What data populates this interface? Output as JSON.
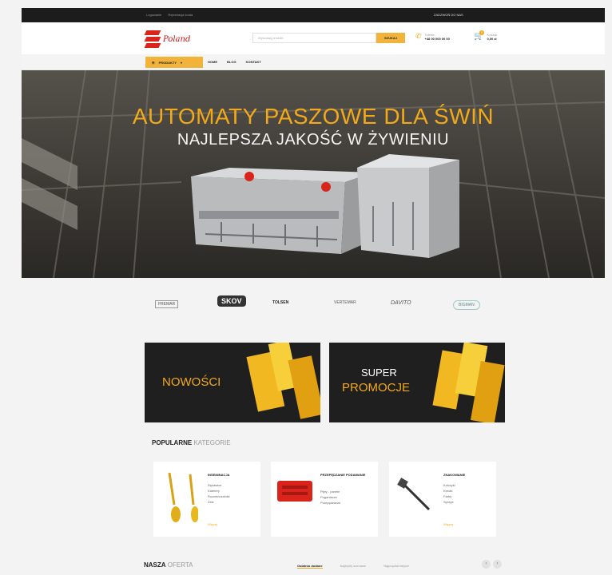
{
  "topbar": {
    "left_links": [
      "Logowanie",
      "Rejestracja konta"
    ],
    "right_text": "ZADZWOŃ DO NAS"
  },
  "header": {
    "logo_text": "Poland",
    "search_placeholder": "Wyszukaj produkt",
    "search_button": "SZUKAJ",
    "phone_label": "Telefon",
    "phone_number": "+48 00 000 00 00",
    "cart_label": "Koszyk",
    "cart_total": "0,00 zł",
    "cart_count": "0"
  },
  "nav": {
    "products_label": "PRODUKTY",
    "items": [
      "HOME",
      "BLOG",
      "KONTAKT"
    ]
  },
  "hero": {
    "title": "AUTOMATY PASZOWE DLA ŚWIŃ",
    "subtitle": "NAJLEPSZA JAKOŚĆ W ŻYWIENIU"
  },
  "brands": [
    "FREMAR",
    "SKOV",
    "TOLSEN",
    "VERTEMAR",
    "DAVITO",
    "BIGMAN"
  ],
  "promos": [
    {
      "line1": "NOWOŚCI",
      "line2": ""
    },
    {
      "line1": "SUPER",
      "line2": "PROMOCJE"
    }
  ],
  "categories": {
    "heading_bold": "POPULARNE",
    "heading_light": "KATEGORIE",
    "cards": [
      {
        "title": "INSEMINACJA",
        "items": [
          "Rękawice",
          "Katetery",
          "Rozcieńczalniki",
          "Żele"
        ],
        "more": "Więcej"
      },
      {
        "title": "PRZEPĘDZANIE PODAWANIE",
        "items": [
          "Płyty - panele",
          "Poganiacze",
          "Przepędzacze"
        ],
        "more": ""
      },
      {
        "title": "ZNAKOWANIE",
        "items": [
          "Kolczyki",
          "Kredki",
          "Farby",
          "Spraye"
        ],
        "more": "Więcej"
      }
    ]
  },
  "offer": {
    "heading_bold": "NASZA",
    "heading_light": "OFERTA",
    "tabs": [
      "Ostatnio dodane",
      "Najlepiej oceniane",
      "Najpopularniejsze"
    ],
    "active_tab": 0
  },
  "colors": {
    "accent": "#f2a91a",
    "dark": "#1c1c1c",
    "brand_red": "#d9241c"
  }
}
